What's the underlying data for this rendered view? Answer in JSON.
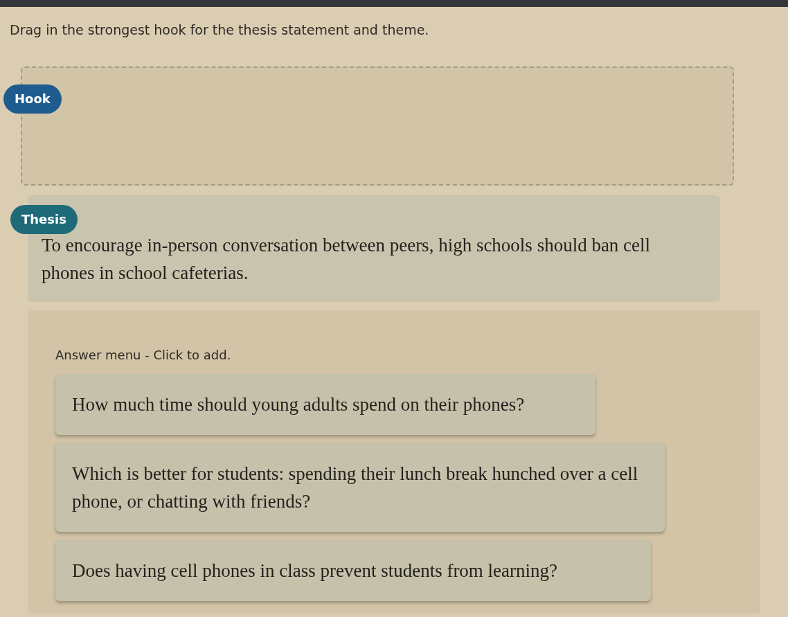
{
  "instruction": "Drag in the strongest hook for the thesis statement and theme.",
  "hook": {
    "label": "Hook"
  },
  "thesis": {
    "label": "Thesis",
    "text": "To encourage in-person conversation between peers, high schools should ban cell phones in school cafeterias."
  },
  "answer_menu": {
    "label": "Answer menu - Click to add.",
    "answers": [
      "How much time should young adults spend on their phones?",
      "Which is better for students: spending their lunch break hunched over a cell phone, or chatting with friends?",
      "Does having cell phones in class prevent students from learning?"
    ]
  }
}
